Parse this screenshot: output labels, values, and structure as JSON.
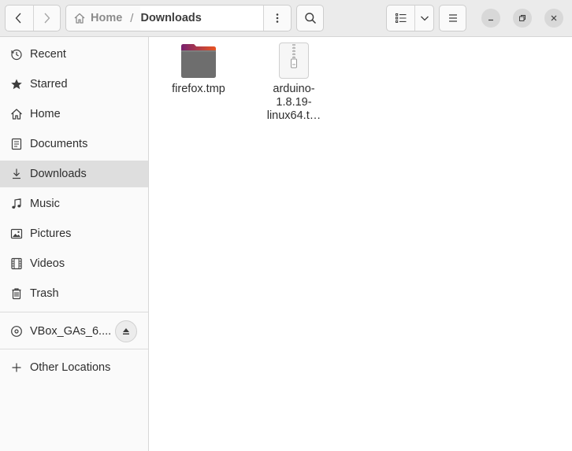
{
  "window": {
    "title": "Downloads"
  },
  "header": {
    "back_icon": "chevron-left-icon",
    "forward_icon": "chevron-right-icon",
    "path": {
      "home_label": "Home",
      "separator": "/",
      "current_label": "Downloads"
    },
    "path_menu_icon": "vertical-dots-icon",
    "search_icon": "search-icon",
    "view_icon": "list-view-icon",
    "view_dropdown_icon": "chevron-down-icon",
    "menu_icon": "hamburger-menu-icon",
    "minimize_icon": "minimize-icon",
    "maximize_icon": "restore-icon",
    "close_icon": "close-icon"
  },
  "sidebar": {
    "items": [
      {
        "label": "Recent",
        "icon": "clock-icon"
      },
      {
        "label": "Starred",
        "icon": "star-icon"
      },
      {
        "label": "Home",
        "icon": "home-icon"
      },
      {
        "label": "Documents",
        "icon": "document-icon"
      },
      {
        "label": "Downloads",
        "icon": "download-icon",
        "active": true
      },
      {
        "label": "Music",
        "icon": "music-icon"
      },
      {
        "label": "Pictures",
        "icon": "picture-icon"
      },
      {
        "label": "Videos",
        "icon": "film-icon"
      },
      {
        "label": "Trash",
        "icon": "trash-icon"
      }
    ],
    "devices": [
      {
        "label": "VBox_GAs_6....",
        "icon": "disc-icon",
        "eject_icon": "eject-icon"
      }
    ],
    "other": {
      "label": "Other Locations",
      "icon": "plus-icon"
    }
  },
  "files": [
    {
      "name": "firefox.tmp",
      "type": "folder"
    },
    {
      "name": "arduino-\n1.8.19-\nlinux64.t…",
      "type": "archive"
    }
  ],
  "colors": {
    "folder_tab": "#e95420",
    "folder_tab_dark": "#77216f",
    "folder_body": "#6e6e6e"
  }
}
